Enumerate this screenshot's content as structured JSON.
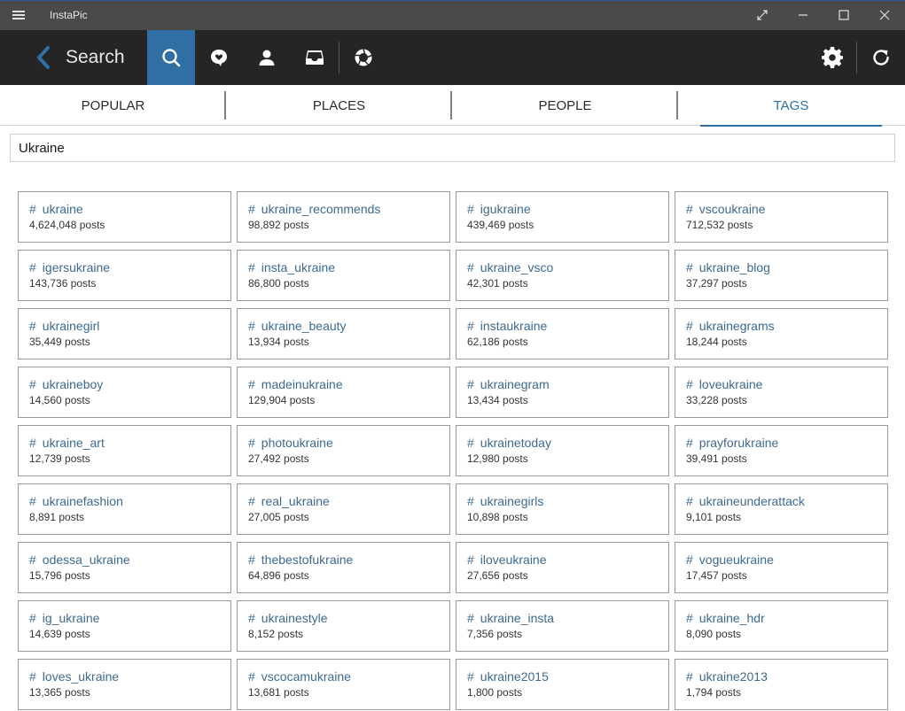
{
  "window": {
    "title": "InstaPic",
    "controls": [
      "restore-down-arrows-icon",
      "minimize-icon",
      "maximize-icon",
      "close-icon"
    ]
  },
  "toolbar": {
    "title": "Search",
    "icons": [
      "back-chevron-icon",
      "search-icon",
      "heart-chat-icon",
      "profile-icon",
      "inbox-icon",
      "camera-shutter-icon",
      "gear-icon",
      "refresh-icon"
    ],
    "active_color": "#2f6fa3"
  },
  "tabs": [
    {
      "label": "POPULAR"
    },
    {
      "label": "PLACES"
    },
    {
      "label": "PEOPLE"
    },
    {
      "label": "TAGS"
    }
  ],
  "search": {
    "value": "Ukraine"
  },
  "results": [
    {
      "tag": "ukraine",
      "count": "4,624,048 posts"
    },
    {
      "tag": "ukraine_recommends",
      "count": "98,892 posts"
    },
    {
      "tag": "igukraine",
      "count": "439,469 posts"
    },
    {
      "tag": "vscoukraine",
      "count": "712,532 posts"
    },
    {
      "tag": "igersukraine",
      "count": "143,736 posts"
    },
    {
      "tag": "insta_ukraine",
      "count": "86,800 posts"
    },
    {
      "tag": "ukraine_vsco",
      "count": "42,301 posts"
    },
    {
      "tag": "ukraine_blog",
      "count": "37,297 posts"
    },
    {
      "tag": "ukrainegirl",
      "count": "35,449 posts"
    },
    {
      "tag": "ukraine_beauty",
      "count": "13,934 posts"
    },
    {
      "tag": "instaukraine",
      "count": "62,186 posts"
    },
    {
      "tag": "ukrainegrams",
      "count": "18,244 posts"
    },
    {
      "tag": "ukraineboy",
      "count": "14,560 posts"
    },
    {
      "tag": "madeinukraine",
      "count": "129,904 posts"
    },
    {
      "tag": "ukrainegram",
      "count": "13,434 posts"
    },
    {
      "tag": "loveukraine",
      "count": "33,228 posts"
    },
    {
      "tag": "ukraine_art",
      "count": "12,739 posts"
    },
    {
      "tag": "photoukraine",
      "count": "27,492 posts"
    },
    {
      "tag": "ukrainetoday",
      "count": "12,980 posts"
    },
    {
      "tag": "prayforukraine",
      "count": "39,491 posts"
    },
    {
      "tag": "ukrainefashion",
      "count": "8,891 posts"
    },
    {
      "tag": "real_ukraine",
      "count": "27,005 posts"
    },
    {
      "tag": "ukrainegirls",
      "count": "10,898 posts"
    },
    {
      "tag": "ukraineunderattack",
      "count": "9,101 posts"
    },
    {
      "tag": "odessa_ukraine",
      "count": "15,796 posts"
    },
    {
      "tag": "thebestofukraine",
      "count": "64,896 posts"
    },
    {
      "tag": "iloveukraine",
      "count": "27,656 posts"
    },
    {
      "tag": "vogueukraine",
      "count": "17,457 posts"
    },
    {
      "tag": "ig_ukraine",
      "count": "14,639 posts"
    },
    {
      "tag": "ukrainestyle",
      "count": "8,152 posts"
    },
    {
      "tag": "ukraine_insta",
      "count": "7,356 posts"
    },
    {
      "tag": "ukraine_hdr",
      "count": "8,090 posts"
    },
    {
      "tag": "loves_ukraine",
      "count": "13,365 posts"
    },
    {
      "tag": "vscocamukraine",
      "count": "13,681 posts"
    },
    {
      "tag": "ukraine2015",
      "count": "1,800 posts"
    },
    {
      "tag": "ukraine2013",
      "count": "1,794 posts"
    }
  ],
  "hash_symbol": "#"
}
